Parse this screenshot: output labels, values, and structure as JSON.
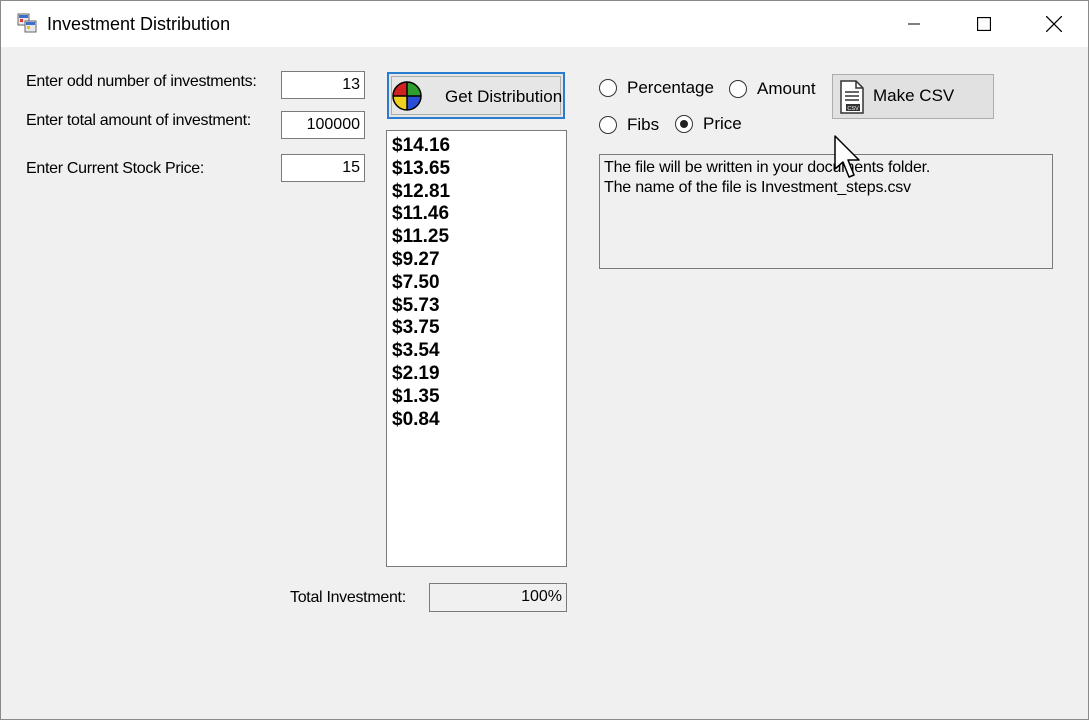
{
  "window": {
    "title": "Investment Distribution",
    "app_icon": "app-window-icon",
    "controls": {
      "minimize": "minimize-icon",
      "maximize": "maximize-icon",
      "close": "close-icon"
    }
  },
  "inputs": {
    "odd_number_label": "Enter odd number of investments:",
    "odd_number_value": "13",
    "total_amount_label": "Enter total amount of investment:",
    "total_amount_value": "100000",
    "stock_price_label": "Enter Current Stock Price:",
    "stock_price_value": "15"
  },
  "get_distribution": {
    "label": "Get Distribution",
    "icon": "pie-chart-icon"
  },
  "results": [
    "$14.16",
    "$13.65",
    "$12.81",
    "$11.46",
    "$11.25",
    "$9.27",
    "$7.50",
    "$5.73",
    "$3.75",
    "$3.54",
    "$2.19",
    "$1.35",
    "$0.84"
  ],
  "options": {
    "percentage": "Percentage",
    "amount": "Amount",
    "fibs": "Fibs",
    "price": "Price",
    "selected": "Price"
  },
  "make_csv": {
    "label": "Make CSV",
    "icon": "csv-file-icon"
  },
  "message": {
    "line1": "The file will be written in your documents folder.",
    "line2": "The name of the file is Investment_steps.csv"
  },
  "total": {
    "label": "Total Investment:",
    "value": "100%"
  }
}
